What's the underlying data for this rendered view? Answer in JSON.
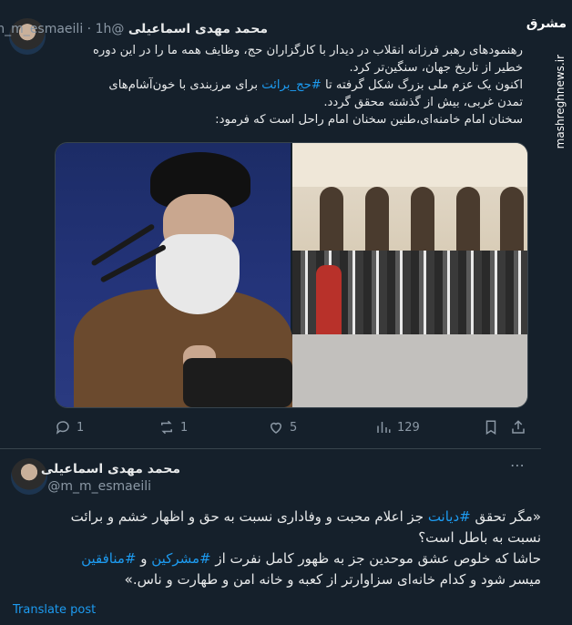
{
  "watermark": {
    "logo": "مشرق",
    "site": "mashreghnews.ir"
  },
  "post1": {
    "author_name": "محمد مهدی اسماعیلی",
    "handle": "@m_m_esmaeili",
    "separator": "·",
    "time": "1h",
    "text_lines": [
      [
        {
          "t": "رهنمودهای رهبر فرزانه انقلاب در دیدار با کارگزاران حج، وظایف همه ما را در این دوره"
        }
      ],
      [
        {
          "t": "خطیر از تاریخ جهان، سنگین‌تر کرد."
        }
      ],
      [
        {
          "t": "اکنون یک عزم ملی بزرگ شکل گرفته تا "
        },
        {
          "t": "#حج_برائت",
          "tag": true
        },
        {
          "t": " برای مرزبندی با خون‌آشام‌های"
        }
      ],
      [
        {
          "t": "تمدن غربی، بیش از گذشته محقق گردد."
        }
      ],
      [
        {
          "t": "سخنان امام خامنه‌ای،طنین سخنان امام راحل است که فرمود:"
        }
      ]
    ],
    "actions": {
      "reply_count": "1",
      "repost_count": "1",
      "like_count": "5",
      "views_count": "129"
    }
  },
  "post2": {
    "author_name": "محمد مهدی اسماعیلی",
    "handle": "@m_m_esmaeili",
    "text_lines": [
      [
        {
          "t": "«مگر تحقق "
        },
        {
          "t": "#دیانت",
          "tag": true
        },
        {
          "t": " جز اعلام محبت و وفاداری نسبت به حق و اظهار خشم و برائت"
        }
      ],
      [
        {
          "t": "نسبت به باطل است؟"
        }
      ],
      [
        {
          "t": "حاشا که خلوص عشق موحدین جز به ظهور کامل نفرت از "
        },
        {
          "t": "#مشرکین",
          "tag": true
        },
        {
          "t": " و "
        },
        {
          "t": "#منافقین",
          "tag": true
        }
      ],
      [
        {
          "t": "میسر شود و کدام خانه‌ای سزاوارتر از کعبه و خانه امن و طهارت و ناس.»"
        }
      ]
    ],
    "translate_label": "Translate post"
  },
  "colors": {
    "background": "#15202b",
    "text": "#e7e9ea",
    "muted": "#8b98a5",
    "accent": "#1d9bf0"
  }
}
